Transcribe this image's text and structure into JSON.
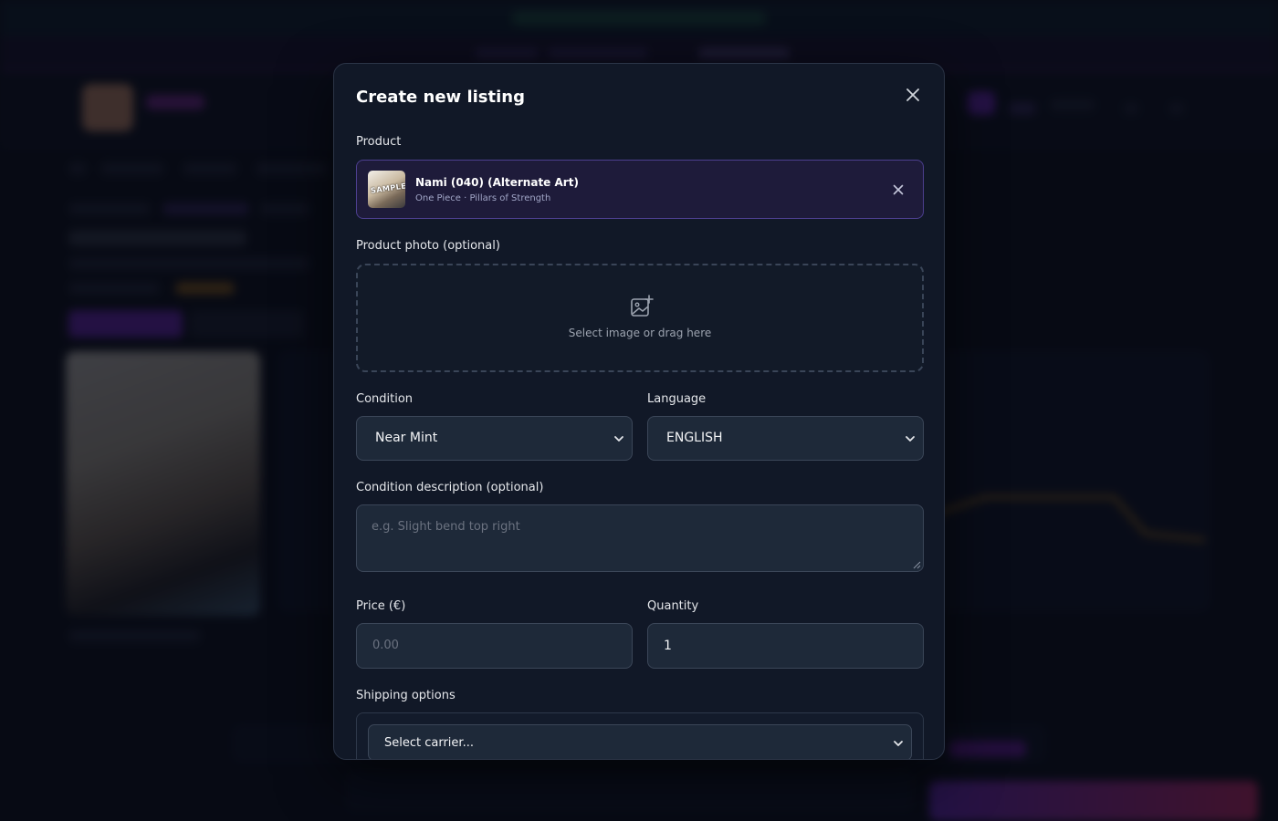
{
  "modal": {
    "title": "Create new listing",
    "product_label": "Product",
    "product": {
      "name": "Nami (040) (Alternate Art)",
      "subtitle": "One Piece · Pillars of Strength",
      "thumb_watermark": "SAMPLE"
    },
    "photo_label": "Product photo (optional)",
    "photo_dropzone_text": "Select image or drag here",
    "condition_label": "Condition",
    "condition_value": "Near Mint",
    "language_label": "Language",
    "language_value": "ENGLISH",
    "condition_description_label": "Condition description (optional)",
    "condition_description_placeholder": "e.g. Slight bend top right",
    "price_label": "Price (€)",
    "price_placeholder": "0.00",
    "quantity_label": "Quantity",
    "quantity_value": "1",
    "shipping_label": "Shipping options",
    "carrier_value": "Select carrier..."
  },
  "icons": {
    "close": "close-icon",
    "remove_product": "close-icon",
    "add_photo": "image-plus-icon",
    "chevron": "chevron-down-icon"
  },
  "colors": {
    "modal_bg": "#111827",
    "field_bg": "#1e2939",
    "product_box_bg": "#1e1b3a",
    "accent_purple": "#7c2bd6",
    "accent_pink": "#ea2f7a"
  }
}
